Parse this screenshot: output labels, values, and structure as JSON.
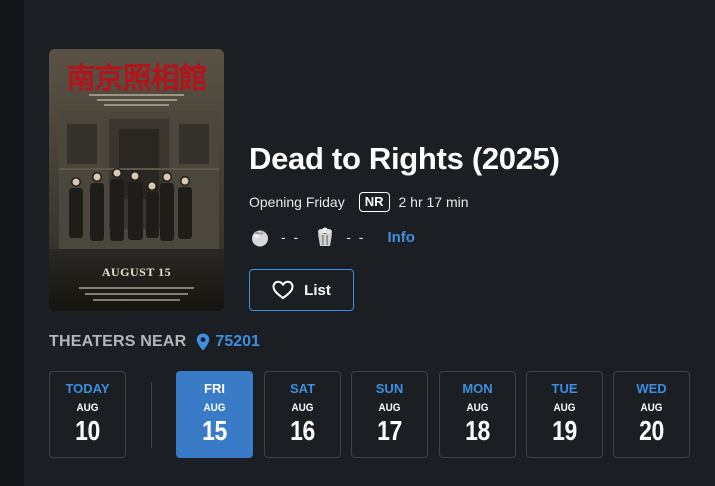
{
  "movie": {
    "title": "Dead to Rights (2025)",
    "opening": "Opening Friday",
    "rating": "NR",
    "runtime": "2 hr 17 min",
    "critics_score": "- -",
    "audience_score": "- -",
    "info_label": "Info",
    "list_label": "List",
    "poster": {
      "title_text": "南京照相館",
      "date_text": "AUGUST 15"
    }
  },
  "theaters": {
    "label": "THEATERS NEAR",
    "zip": "75201"
  },
  "dates": [
    {
      "dow": "TODAY",
      "mon": "AUG",
      "day": "10",
      "selected": false
    },
    {
      "dow": "FRI",
      "mon": "AUG",
      "day": "15",
      "selected": true
    },
    {
      "dow": "SAT",
      "mon": "AUG",
      "day": "16",
      "selected": false
    },
    {
      "dow": "SUN",
      "mon": "AUG",
      "day": "17",
      "selected": false
    },
    {
      "dow": "MON",
      "mon": "AUG",
      "day": "18",
      "selected": false
    },
    {
      "dow": "TUE",
      "mon": "AUG",
      "day": "19",
      "selected": false
    },
    {
      "dow": "WED",
      "mon": "AUG",
      "day": "20",
      "selected": false
    }
  ],
  "colors": {
    "background": "#1b1e22",
    "accent": "#3d8fe0",
    "selected": "#3a7bc8",
    "poster_title": "#b3141c"
  },
  "icons": {
    "critics": "tomato-icon",
    "audience": "popcorn-icon",
    "list": "heart-icon",
    "location": "map-pin-icon"
  }
}
